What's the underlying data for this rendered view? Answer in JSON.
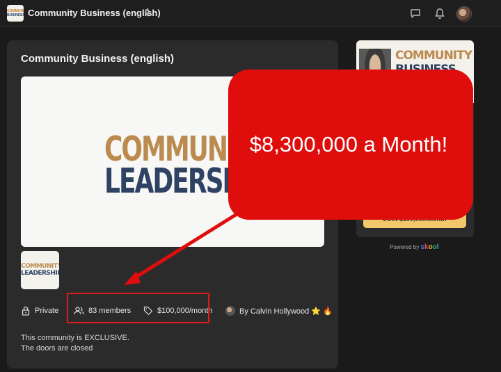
{
  "topbar": {
    "logo_line1": "COMMUNITY",
    "logo_line2": "BUSINESS",
    "title": "Community Business (english)",
    "icons": [
      "chevron-updown-icon",
      "chat-icon",
      "bell-icon",
      "avatar"
    ]
  },
  "card": {
    "title": "Community Business (english)",
    "hero_line1": "COMMUNITY",
    "hero_line2": "LEADERSHIP",
    "thumb_line1": "COMMUNITY",
    "thumb_line2": "LEADERSHIP",
    "privacy": "Private",
    "members": "83 members",
    "price": "$100,000/month",
    "author": "By Calvin Hollywood ⭐ 🔥",
    "desc_line1": "This community is EXCLUSIVE.",
    "desc_line2": "The doors are closed"
  },
  "side": {
    "img_line1": "COMMUNITY",
    "img_line2": "BUSINESS",
    "button": "JOIN $100,000/month"
  },
  "powered": {
    "label": "Powered by",
    "brand": "skool"
  },
  "callout": {
    "text": "$8,300,000 a Month!"
  },
  "colors": {
    "accent_red": "#e00d0d",
    "gold": "#bb8a4f",
    "navy": "#2e4263"
  }
}
